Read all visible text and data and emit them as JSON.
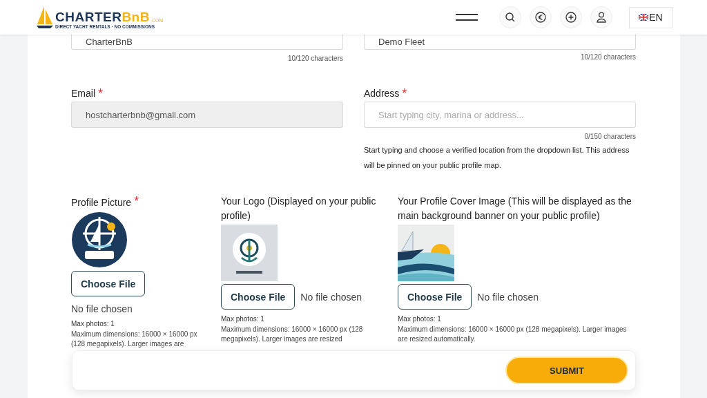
{
  "header": {
    "logo": {
      "name_main": "CHARTER",
      "name_accent": "BnB",
      "suffix": ".COM",
      "tagline": "DIRECT YACHT RENTALS · NO COMMISSIONS"
    },
    "language": "EN"
  },
  "top_fields": [
    {
      "value": "CharterBnB",
      "counter": "10/120 characters"
    },
    {
      "value": "Demo Fleet",
      "counter": "10/120 characters"
    }
  ],
  "email": {
    "label": "Email",
    "required_mark": "*",
    "value": "hostcharterbnb@gmail.com",
    "disabled": true
  },
  "address": {
    "label": "Address",
    "required_mark": "*",
    "placeholder": "Start typing city, marina or address...",
    "counter": "0/150 characters",
    "help": "Start typing and choose a verified location from the dropdown list. This address will be pinned on your public profile map."
  },
  "uploads": [
    {
      "label": "Profile Picture",
      "required_mark": "*",
      "kind": "picture",
      "button": "Choose File",
      "status": "No file chosen",
      "max": "Max photos: 1",
      "note": "Maximum dimensions: 16000 × 16000 px (128 megapixels). Larger images are"
    },
    {
      "label": "Your Logo (Displayed on your public profile)",
      "kind": "picture",
      "button": "Choose File",
      "status": "No file chosen",
      "max": "Max photos: 1",
      "note": "Maximum dimensions: 16000 × 16000 px (128 megapixels). Larger images are resized"
    },
    {
      "label": "Your Profile Cover Image (This will be displayed as the main background banner on your public profile)",
      "kind": "picture",
      "button": "Choose File",
      "status": "No file chosen",
      "max": "Max photos: 1",
      "note": "Maximum dimensions: 16000 × 16000 px (128 megapixels). Larger images are resized automatically."
    }
  ],
  "submit": "SUBMIT"
}
